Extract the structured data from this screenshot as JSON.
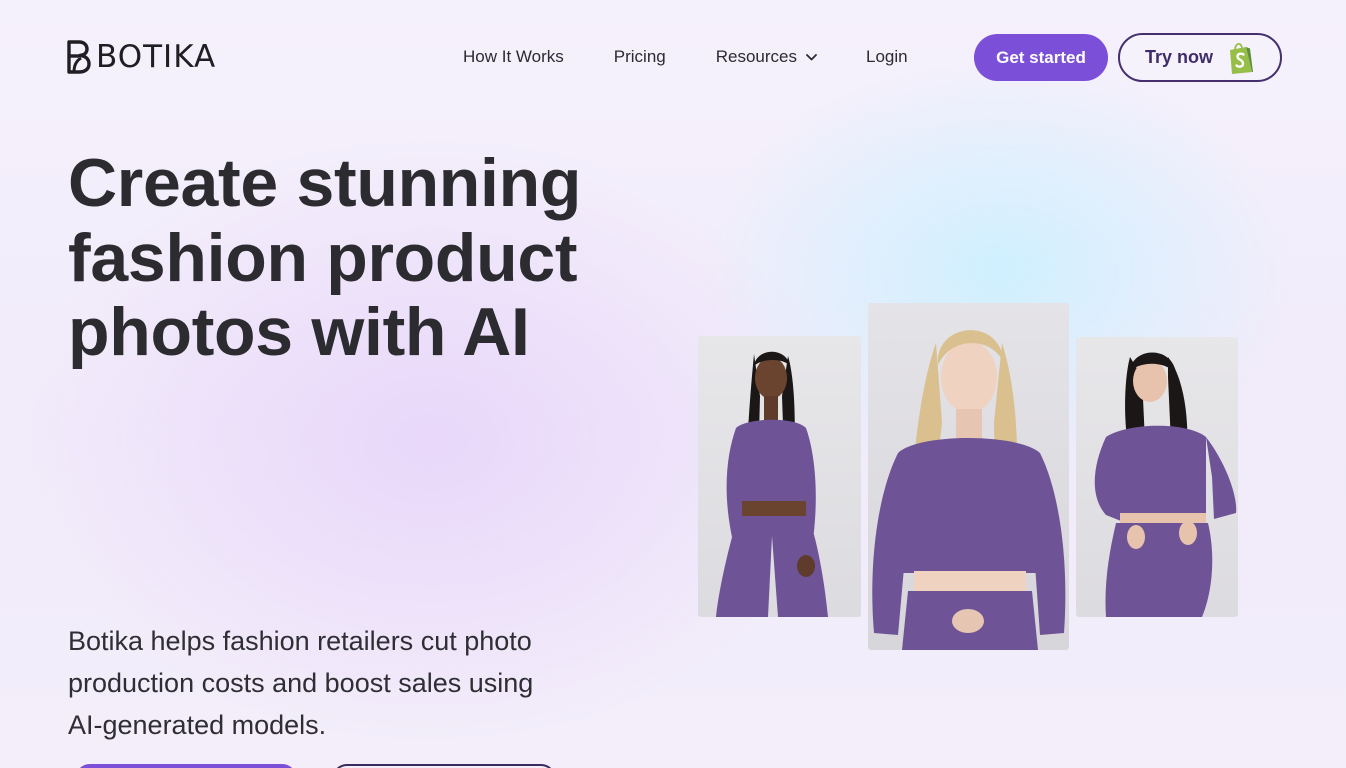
{
  "brand": {
    "name": "BOTIKA",
    "logo_icon": "botika-b-mark-icon"
  },
  "nav": {
    "links": [
      {
        "label": "How It Works"
      },
      {
        "label": "Pricing"
      },
      {
        "label": "Resources",
        "icon": "chevron-down-icon"
      },
      {
        "label": "Login"
      }
    ],
    "get_started_label": "Get started",
    "try_now_label": "Try now",
    "try_now_icon": "shopify-bag-icon"
  },
  "hero": {
    "title": "Create stunning fashion product photos with AI",
    "subtitle": "Botika helps fashion retailers cut photo production costs and boost sales using AI-generated models."
  },
  "gallery": {
    "images": [
      {
        "name": "model-photo-left",
        "description_icon": "model-photo"
      },
      {
        "name": "model-photo-center",
        "description_icon": "model-photo"
      },
      {
        "name": "model-photo-right",
        "description_icon": "model-photo"
      }
    ]
  },
  "colors": {
    "accent": "#7b4fd8",
    "dark_outline": "#45306d",
    "heading": "#2c2b30",
    "outfit": "#6e5497",
    "shopify_green": "#95bf47"
  }
}
